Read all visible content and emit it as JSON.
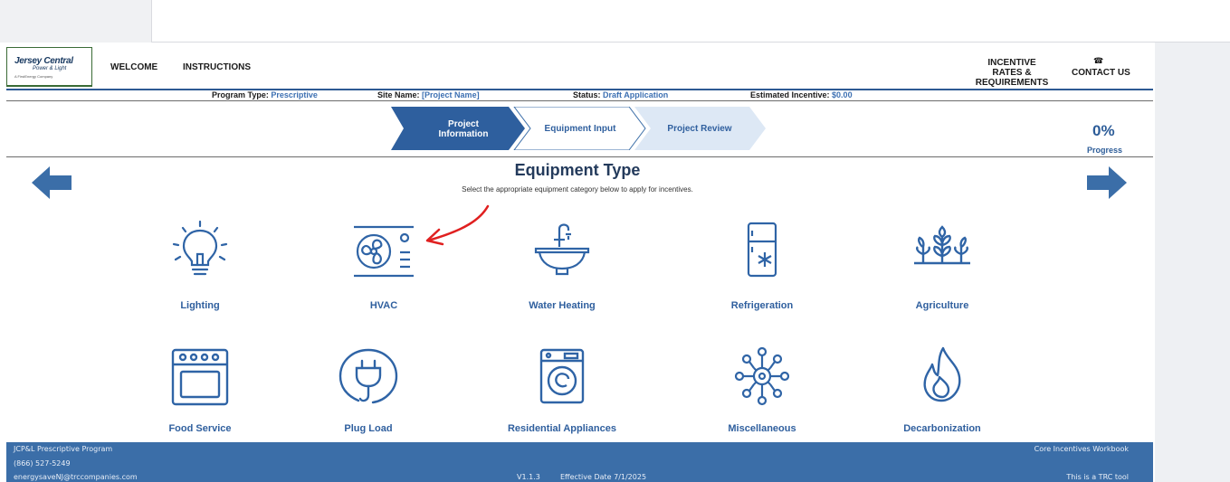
{
  "header": {
    "logo_name": "Jersey Central",
    "logo_sub": "Power & Light",
    "logo_company": "A FirstEnergy Company",
    "nav_welcome": "WELCOME",
    "nav_instructions": "INSTRUCTIONS",
    "nav_rates_line1": "INCENTIVE RATES &",
    "nav_rates_line2": "REQUIREMENTS",
    "nav_contact": "CONTACT US",
    "phone_icon": "☎"
  },
  "info": {
    "program_type_label": "Program Type:",
    "program_type_value": "Prescriptive",
    "site_name_label": "Site Name:",
    "site_name_value": "[Project Name]",
    "status_label": "Status:",
    "status_value": "Draft Application",
    "estimated_label": "Estimated Incentive:",
    "estimated_value": "$0.00"
  },
  "steps": {
    "step1_line1": "Project",
    "step1_line2": "Information",
    "step2": "Equipment Input",
    "step3": "Project Review",
    "progress_value": "0%",
    "progress_label": "Progress"
  },
  "main": {
    "title": "Equipment Type",
    "subtitle": "Select the appropriate equipment category below to apply for incentives."
  },
  "equipment": [
    {
      "label": "Lighting",
      "icon": "light-bulb-icon"
    },
    {
      "label": "HVAC",
      "icon": "hvac-unit-icon"
    },
    {
      "label": "Water Heating",
      "icon": "faucet-sink-icon"
    },
    {
      "label": "Refrigeration",
      "icon": "refrigerator-icon"
    },
    {
      "label": "Agriculture",
      "icon": "wheat-icon"
    },
    {
      "label": "Food Service",
      "icon": "oven-icon"
    },
    {
      "label": "Plug Load",
      "icon": "plug-icon"
    },
    {
      "label": "Residential Appliances",
      "icon": "washing-machine-icon"
    },
    {
      "label": "Miscellaneous",
      "icon": "network-gear-icon"
    },
    {
      "label": "Decarbonization",
      "icon": "flame-icon"
    }
  ],
  "footer": {
    "program": "JCP&L Prescriptive Program",
    "phone": "(866) 527-5249",
    "email": "energysaveNJ@trccompanies.com",
    "version": "V1.1.3",
    "effective": "Effective Date 7/1/2025",
    "workbook": "Core Incentives Workbook",
    "tool": "This is a TRC tool"
  },
  "colors": {
    "accent": "#3b6ea8",
    "step_active": "#2e5f9e",
    "step_inactive": "#dde8f5",
    "annotation": "#e02020"
  }
}
